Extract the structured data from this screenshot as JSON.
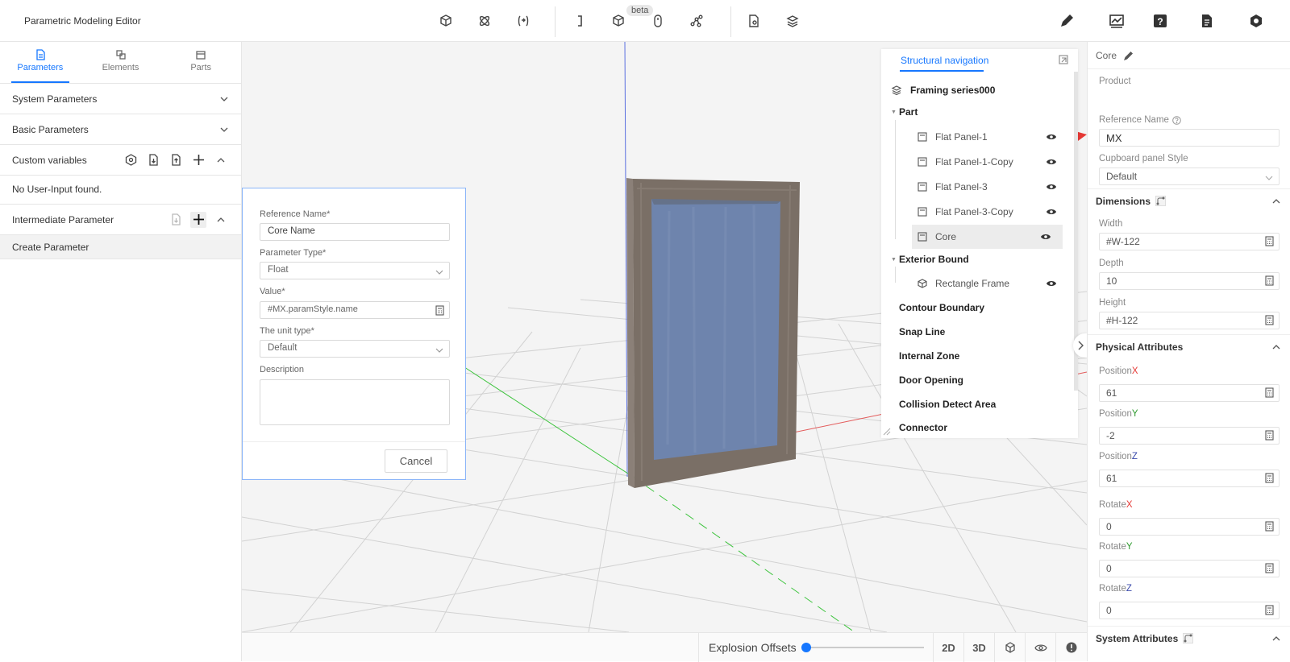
{
  "app": {
    "title": "Parametric Modeling Editor"
  },
  "toolbar": {
    "beta_label": "beta"
  },
  "left": {
    "tabs": [
      {
        "label": "Parameters"
      },
      {
        "label": "Elements"
      },
      {
        "label": "Parts"
      }
    ],
    "sections": {
      "system": "System Parameters",
      "basic": "Basic Parameters",
      "custom": "Custom variables",
      "custom_empty": "No User-Input found.",
      "intermediate": "Intermediate Parameter",
      "create": "Create Parameter"
    }
  },
  "dialog": {
    "ref_label": "Reference Name*",
    "ref_value": "Core Name",
    "type_label": "Parameter Type*",
    "type_value": "Float",
    "value_label": "Value*",
    "value_value": "#MX.paramStyle.name",
    "unit_label": "The unit type*",
    "unit_value": "Default",
    "desc_label": "Description",
    "cancel": "Cancel"
  },
  "nav": {
    "title": "Structural navigation",
    "root": "Framing series000",
    "part_header": "Part",
    "parts": [
      "Flat Panel-1",
      "Flat Panel-1-Copy",
      "Flat Panel-3",
      "Flat Panel-3-Copy",
      "Core"
    ],
    "exterior_header": "Exterior Bound",
    "exterior_items": [
      "Rectangle Frame"
    ],
    "groups": [
      "Contour Boundary",
      "Snap Line",
      "Internal Zone",
      "Door Opening",
      "Collision Detect Area",
      "Connector"
    ]
  },
  "bottom": {
    "explosion": "Explosion Offsets",
    "btn2d": "2D",
    "btn3d": "3D"
  },
  "right": {
    "title": "Core",
    "product_label": "Product",
    "refname_label": "Reference Name",
    "refname_value": "MX",
    "style_label": "Cupboard panel Style",
    "style_value": "Default",
    "dimensions": "Dimensions",
    "width_label": "Width",
    "width_value": "#W-122",
    "depth_label": "Depth",
    "depth_value": "10",
    "height_label": "Height",
    "height_value": "#H-122",
    "physical": "Physical Attributes",
    "posx_prefix": "Position",
    "posx_axis": "X",
    "posx_value": "61",
    "posy_prefix": "Position",
    "posy_axis": "Y",
    "posy_value": "-2",
    "posz_prefix": "Position",
    "posz_axis": "Z",
    "posz_value": "61",
    "rotx_prefix": "Rotate",
    "rotx_axis": "X",
    "rotx_value": "0",
    "roty_prefix": "Rotate",
    "roty_axis": "Y",
    "roty_value": "0",
    "rotz_prefix": "Rotate",
    "rotz_axis": "Z",
    "rotz_value": "0",
    "system": "System Attributes"
  },
  "colors": {
    "accent": "#1677ff",
    "axis_x": "#e53935",
    "axis_y": "#2e9b2e",
    "axis_z": "#3949ab",
    "panel": "#6e84ad",
    "frame": "#7a6f66"
  }
}
